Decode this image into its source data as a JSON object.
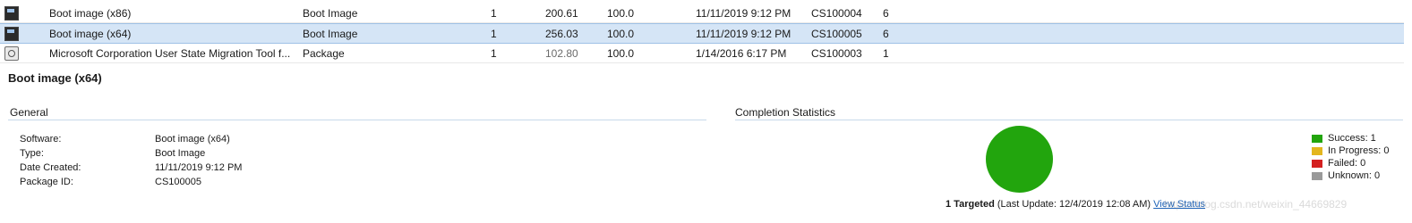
{
  "rows": [
    {
      "icon": "boot-image-icon",
      "name": "Boot image (x86)",
      "type": "Boot Image",
      "version": "1",
      "size": "200.61",
      "percent": "100.0",
      "date": "11/11/2019 9:12 PM",
      "package_id": "CS100004",
      "count": "6"
    },
    {
      "icon": "boot-image-icon",
      "name": "Boot image (x64)",
      "type": "Boot Image",
      "version": "1",
      "size": "256.03",
      "percent": "100.0",
      "date": "11/11/2019 9:12 PM",
      "package_id": "CS100005",
      "count": "6"
    },
    {
      "icon": "package-icon",
      "name": "Microsoft Corporation User State Migration Tool f...",
      "type": "Package",
      "version": "1",
      "size": "102.80",
      "percent": "100.0",
      "date": "1/14/2016 6:17 PM",
      "package_id": "CS100003",
      "count": "1"
    }
  ],
  "detail": {
    "title": "Boot image (x64)",
    "general_header": "General",
    "completion_header": "Completion Statistics",
    "fields": [
      {
        "label": "Software:",
        "value": "Boot image (x64)"
      },
      {
        "label": "Type:",
        "value": "Boot Image"
      },
      {
        "label": "Date Created:",
        "value": "11/11/2019 9:12 PM"
      },
      {
        "label": "Package ID:",
        "value": "CS100005"
      }
    ],
    "legend": [
      {
        "label": "Success: 1",
        "color": "#22a50d"
      },
      {
        "label": "In Progress: 0",
        "color": "#e3b61e"
      },
      {
        "label": "Failed: 0",
        "color": "#d42020"
      },
      {
        "label": "Unknown: 0",
        "color": "#9a9a9a"
      }
    ],
    "chart_data": {
      "type": "pie",
      "categories": [
        "Success",
        "In Progress",
        "Failed",
        "Unknown"
      ],
      "values": [
        1,
        0,
        0,
        0
      ]
    },
    "targeted": "1 Targeted",
    "last_update": "(Last Update: 12/4/2019 12:08 AM)",
    "view_status": "View Status"
  },
  "watermark": "https://blog.csdn.net/weixin_44669829"
}
